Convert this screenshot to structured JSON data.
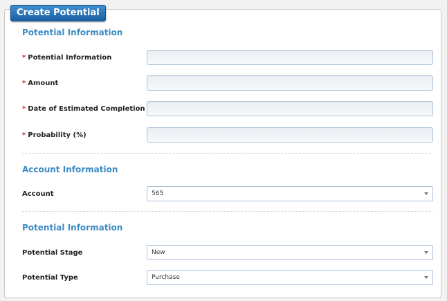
{
  "form": {
    "title": "Create Potential",
    "required_marker": "*",
    "sections": [
      {
        "heading": "Potential Information",
        "fields": [
          {
            "label": "Potential Information",
            "required": true,
            "value": ""
          },
          {
            "label": "Amount",
            "required": true,
            "value": ""
          },
          {
            "label": "Date of Estimated Completion",
            "required": true,
            "value": ""
          },
          {
            "label": "Probability (%)",
            "required": true,
            "value": ""
          }
        ]
      },
      {
        "heading": "Account Information",
        "fields": [
          {
            "label": "Account",
            "required": false,
            "selected": "565"
          }
        ]
      },
      {
        "heading": "Potential Information",
        "fields": [
          {
            "label": "Potential Stage",
            "required": false,
            "selected": "New"
          },
          {
            "label": "Potential Type",
            "required": false,
            "selected": "Purchase"
          }
        ]
      }
    ]
  },
  "colors": {
    "accent": "#3a8cc4",
    "title_tab": "#1c5fa3",
    "required": "#d21f1f"
  },
  "icons": {
    "dropdown": "chevron-down-icon"
  }
}
